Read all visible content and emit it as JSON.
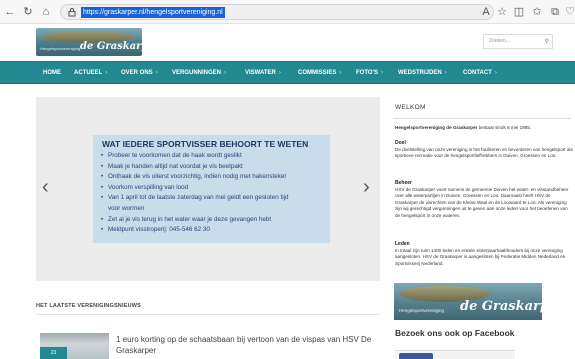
{
  "browser": {
    "url": "https://graskarper.nl/hengelsportvereniging.nl"
  },
  "header": {
    "logo_small": "Hengelsportvereniging",
    "logo_big": "de Graskarper",
    "search_placeholder": "Zoeken..."
  },
  "nav": {
    "items": [
      {
        "label": "HOME",
        "chevron": ""
      },
      {
        "label": "ACTUEEL",
        "chevron": "›"
      },
      {
        "label": "OVER ONS",
        "chevron": "›"
      },
      {
        "label": "VERGUNNINGEN",
        "chevron": "›"
      },
      {
        "label": "VISWATER",
        "chevron": "›"
      },
      {
        "label": "COMMISSIES",
        "chevron": "›"
      },
      {
        "label": "FOTO'S",
        "chevron": "›"
      },
      {
        "label": "WEDSTRIJDEN",
        "chevron": "›"
      },
      {
        "label": "CONTACT",
        "chevron": "›"
      }
    ]
  },
  "slider": {
    "title": "WAT IEDERE SPORTVISSER BEHOORT TE WETEN",
    "bullets": [
      "Probeer te voorkomen dat de haak wordt geslikt",
      "Maak je handen altijd nat voordat je vis beetpakt",
      "Onthaak de vis uiterst voorzichtig, indien nodig met hakensteker",
      "Voorkom verspilling van lood",
      "Van 1 april tot de laatste zaterdag van mei geldt een gesloten tijd",
      "voor wormen",
      "Zet al je vis terug in het water waar je deze gevangen hebt",
      "Meldpunt visstroperij: 045-546 62 30"
    ],
    "prev": "‹",
    "next": "›"
  },
  "news": {
    "section_title": "HET LAATSTE VERENIGINGSNIEUWS",
    "items": [
      {
        "date": "23",
        "title": "1 euro korting op de schaatsbaan bij vertoon van de vispas van HSV De Graskarper"
      }
    ]
  },
  "sidebar": {
    "heading": "WELKOM",
    "intro_bold": "Hengelsportvereniging de Graskarper",
    "intro_rest": " bestaat sinds 8 mei 1985.",
    "doel_title": "Doel",
    "doel_text": "De doelstelling van onze vereniging is het faciliteren en bevorderen van hengelsport als sportieve recreatie voor de hengelsportliefhebbers in Duiven, Groessen en Loo.",
    "beheer_title": "Beheer",
    "beheer_text": "HSV de Graskarper voert namens de gemeente Duiven het water- en visstandbeheer over alle waterpartijen in Duiven, Groessen en Loo. Daarnaast heeft HSV de Graskarper de visrechten van de Kleine Waal en de Loowaard te Loo. Als vereniging zijn wij gerechtigd vergunningen uit te geven aan onze leden voor het beoefenen van de hengelsport in onze wateren.",
    "leden_title": "Leden",
    "leden_text": "In totaal zijn ruim 1400 leden en enkele sloterpaarhaalthouders bij onze vereniging aangesloten. HSV de Graskarper is aangesloten bij Federatie Midden Nederland en Sportvisserij Nederland.",
    "logo_small": "Hengelsportvereniging",
    "logo_big": "de Graskarper",
    "facebook_heading": "Bezoek ons ook op Facebook"
  },
  "colors": {
    "nav_bg": "#23888f",
    "slide_bg": "#c9dce9",
    "slide_text": "#26467a"
  }
}
